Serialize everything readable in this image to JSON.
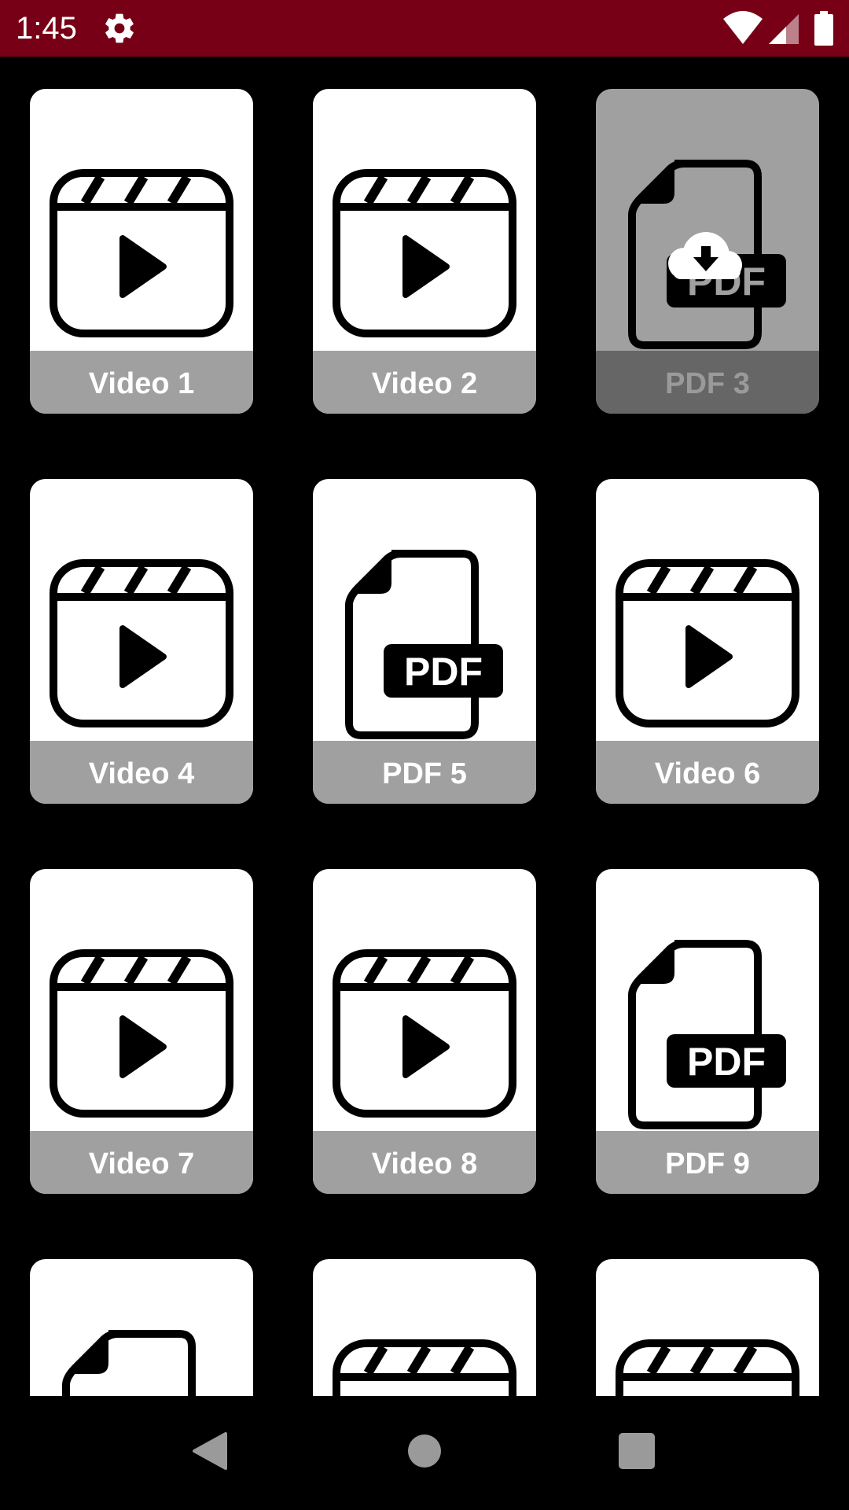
{
  "status_bar": {
    "time": "1:45",
    "color": "#780016",
    "icons": [
      "gear-icon",
      "wifi-icon",
      "signal-icon",
      "battery-icon"
    ]
  },
  "grid": {
    "items": [
      {
        "label": "Video 1",
        "type": "video",
        "state": "available"
      },
      {
        "label": "Video 2",
        "type": "video",
        "state": "available"
      },
      {
        "label": "PDF 3",
        "type": "pdf",
        "state": "download"
      },
      {
        "label": "Video 4",
        "type": "video",
        "state": "available"
      },
      {
        "label": "PDF 5",
        "type": "pdf",
        "state": "available"
      },
      {
        "label": "Video 6",
        "type": "video",
        "state": "available"
      },
      {
        "label": "Video 7",
        "type": "video",
        "state": "available"
      },
      {
        "label": "Video 8",
        "type": "video",
        "state": "available"
      },
      {
        "label": "PDF 9",
        "type": "pdf",
        "state": "available"
      },
      {
        "label": "",
        "type": "pdf",
        "state": "available"
      },
      {
        "label": "",
        "type": "video",
        "state": "available"
      },
      {
        "label": "",
        "type": "video",
        "state": "available"
      }
    ]
  },
  "nav_bar": {
    "buttons": [
      "back-icon",
      "home-icon",
      "recents-icon"
    ]
  }
}
